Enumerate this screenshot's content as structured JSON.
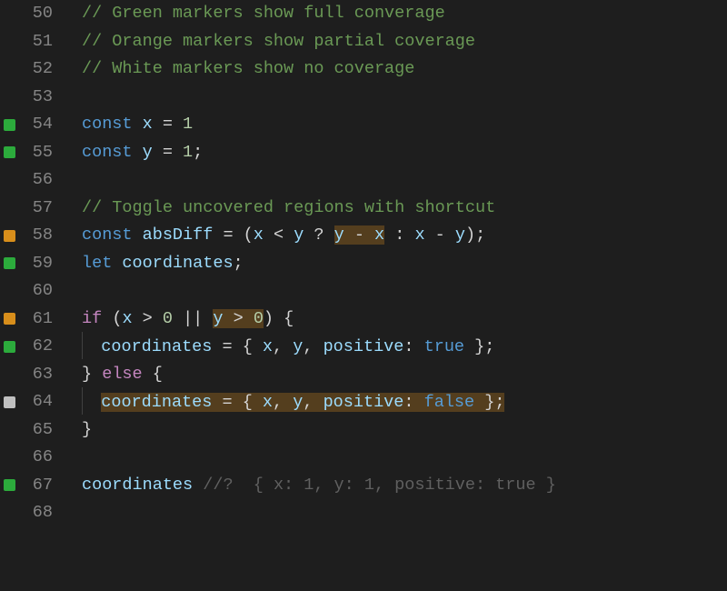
{
  "lines": [
    {
      "ln": 50,
      "cov": null,
      "indent": 0,
      "tokens": [
        {
          "t": "// Green markers show full converage",
          "c": "cmt"
        }
      ]
    },
    {
      "ln": 51,
      "cov": null,
      "indent": 0,
      "tokens": [
        {
          "t": "// Orange markers show partial coverage",
          "c": "cmt"
        }
      ]
    },
    {
      "ln": 52,
      "cov": null,
      "indent": 0,
      "tokens": [
        {
          "t": "// White markers show no coverage",
          "c": "cmt"
        }
      ]
    },
    {
      "ln": 53,
      "cov": null,
      "indent": 0,
      "tokens": []
    },
    {
      "ln": 54,
      "cov": "green",
      "indent": 0,
      "tokens": [
        {
          "t": "const",
          "c": "kw"
        },
        {
          "t": " ",
          "c": "pun"
        },
        {
          "t": "x",
          "c": "var"
        },
        {
          "t": " = ",
          "c": "pun"
        },
        {
          "t": "1",
          "c": "num"
        }
      ]
    },
    {
      "ln": 55,
      "cov": "green",
      "indent": 0,
      "tokens": [
        {
          "t": "const",
          "c": "kw"
        },
        {
          "t": " ",
          "c": "pun"
        },
        {
          "t": "y",
          "c": "var"
        },
        {
          "t": " = ",
          "c": "pun"
        },
        {
          "t": "1",
          "c": "num"
        },
        {
          "t": ";",
          "c": "pun"
        }
      ]
    },
    {
      "ln": 56,
      "cov": null,
      "indent": 0,
      "tokens": []
    },
    {
      "ln": 57,
      "cov": null,
      "indent": 0,
      "tokens": [
        {
          "t": "// Toggle uncovered regions with shortcut",
          "c": "cmt"
        }
      ]
    },
    {
      "ln": 58,
      "cov": "orange",
      "indent": 0,
      "tokens": [
        {
          "t": "const",
          "c": "kw"
        },
        {
          "t": " ",
          "c": "pun"
        },
        {
          "t": "absDiff",
          "c": "var"
        },
        {
          "t": " = (",
          "c": "pun"
        },
        {
          "t": "x",
          "c": "var"
        },
        {
          "t": " < ",
          "c": "pun"
        },
        {
          "t": "y",
          "c": "var"
        },
        {
          "t": " ? ",
          "c": "pun"
        },
        {
          "t": "y",
          "c": "var",
          "hl": true
        },
        {
          "t": " - ",
          "c": "pun",
          "hl": true
        },
        {
          "t": "x",
          "c": "var",
          "hl": true
        },
        {
          "t": " : ",
          "c": "pun"
        },
        {
          "t": "x",
          "c": "var"
        },
        {
          "t": " - ",
          "c": "pun"
        },
        {
          "t": "y",
          "c": "var"
        },
        {
          "t": ");",
          "c": "pun"
        }
      ]
    },
    {
      "ln": 59,
      "cov": "green",
      "indent": 0,
      "tokens": [
        {
          "t": "let",
          "c": "kw"
        },
        {
          "t": " ",
          "c": "pun"
        },
        {
          "t": "coordinates",
          "c": "var"
        },
        {
          "t": ";",
          "c": "pun"
        }
      ]
    },
    {
      "ln": 60,
      "cov": null,
      "indent": 0,
      "tokens": []
    },
    {
      "ln": 61,
      "cov": "orange",
      "indent": 0,
      "tokens": [
        {
          "t": "if",
          "c": "kwc"
        },
        {
          "t": " (",
          "c": "pun"
        },
        {
          "t": "x",
          "c": "var"
        },
        {
          "t": " > ",
          "c": "pun"
        },
        {
          "t": "0",
          "c": "num"
        },
        {
          "t": " || ",
          "c": "pun"
        },
        {
          "t": "y",
          "c": "var",
          "hl": true
        },
        {
          "t": " > ",
          "c": "pun",
          "hl": true
        },
        {
          "t": "0",
          "c": "num",
          "hl": true
        },
        {
          "t": ") {",
          "c": "pun"
        }
      ]
    },
    {
      "ln": 62,
      "cov": "green",
      "indent": 1,
      "tokens": [
        {
          "t": "coordinates",
          "c": "var"
        },
        {
          "t": " = { ",
          "c": "pun"
        },
        {
          "t": "x",
          "c": "prop"
        },
        {
          "t": ", ",
          "c": "pun"
        },
        {
          "t": "y",
          "c": "prop"
        },
        {
          "t": ", ",
          "c": "pun"
        },
        {
          "t": "positive",
          "c": "prop"
        },
        {
          "t": ": ",
          "c": "pun"
        },
        {
          "t": "true",
          "c": "kw"
        },
        {
          "t": " };",
          "c": "pun"
        }
      ]
    },
    {
      "ln": 63,
      "cov": null,
      "indent": 0,
      "tokens": [
        {
          "t": "} ",
          "c": "pun"
        },
        {
          "t": "else",
          "c": "kwc"
        },
        {
          "t": " {",
          "c": "pun"
        }
      ]
    },
    {
      "ln": 64,
      "cov": "white",
      "indent": 1,
      "tokens": [
        {
          "t": "coordinates",
          "c": "var",
          "hl": true
        },
        {
          "t": " = { ",
          "c": "pun",
          "hl": true
        },
        {
          "t": "x",
          "c": "prop",
          "hl": true
        },
        {
          "t": ", ",
          "c": "pun",
          "hl": true
        },
        {
          "t": "y",
          "c": "prop",
          "hl": true
        },
        {
          "t": ", ",
          "c": "pun",
          "hl": true
        },
        {
          "t": "positive",
          "c": "prop",
          "hl": true
        },
        {
          "t": ": ",
          "c": "pun",
          "hl": true
        },
        {
          "t": "false",
          "c": "kw",
          "hl": true
        },
        {
          "t": " };",
          "c": "pun",
          "hl": true
        }
      ]
    },
    {
      "ln": 65,
      "cov": null,
      "indent": 0,
      "tokens": [
        {
          "t": "}",
          "c": "pun"
        }
      ]
    },
    {
      "ln": 66,
      "cov": null,
      "indent": 0,
      "tokens": []
    },
    {
      "ln": 67,
      "cov": "green",
      "indent": 0,
      "tokens": [
        {
          "t": "coordinates",
          "c": "var"
        },
        {
          "t": " ",
          "c": "pun"
        },
        {
          "t": "//?  { x: 1, y: 1, positive: true }",
          "c": "hint"
        }
      ]
    },
    {
      "ln": 68,
      "cov": null,
      "indent": 0,
      "tokens": []
    }
  ]
}
